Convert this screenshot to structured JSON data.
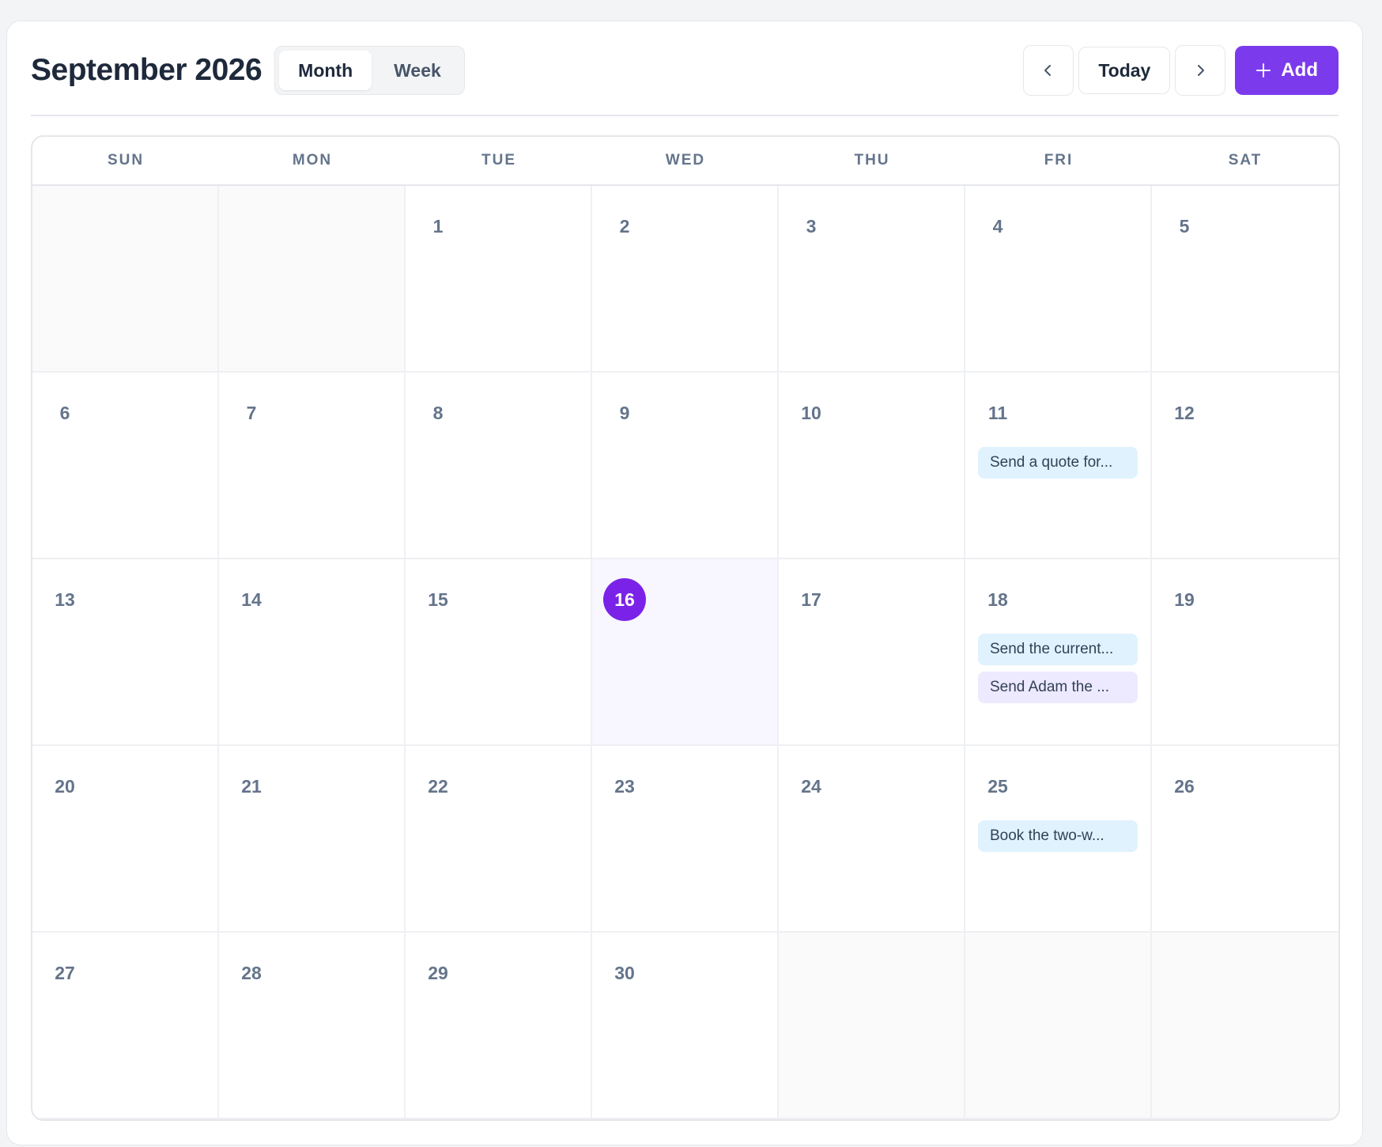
{
  "header": {
    "title": "September 2026",
    "view_toggle": {
      "month_label": "Month",
      "week_label": "Week",
      "active": "Month"
    },
    "prev_icon": "chevron-left-icon",
    "today_label": "Today",
    "next_icon": "chevron-right-icon",
    "add_label": "Add",
    "add_icon": "plus-icon",
    "accent_color": "#7c3aed"
  },
  "weekdays": [
    "SUN",
    "MON",
    "TUE",
    "WED",
    "THU",
    "FRI",
    "SAT"
  ],
  "weeks": [
    [
      {
        "day": ""
      },
      {
        "day": ""
      },
      {
        "day": "1"
      },
      {
        "day": "2"
      },
      {
        "day": "3"
      },
      {
        "day": "4"
      },
      {
        "day": "5"
      }
    ],
    [
      {
        "day": "6"
      },
      {
        "day": "7"
      },
      {
        "day": "8"
      },
      {
        "day": "9"
      },
      {
        "day": "10"
      },
      {
        "day": "11",
        "events": [
          {
            "title": "Send a quote for...",
            "color": "blue"
          }
        ]
      },
      {
        "day": "12"
      }
    ],
    [
      {
        "day": "13"
      },
      {
        "day": "14"
      },
      {
        "day": "15"
      },
      {
        "day": "16",
        "today": true
      },
      {
        "day": "17"
      },
      {
        "day": "18",
        "events": [
          {
            "title": "Send the current...",
            "color": "blue"
          },
          {
            "title": "Send Adam the ...",
            "color": "purple"
          }
        ]
      },
      {
        "day": "19"
      }
    ],
    [
      {
        "day": "20"
      },
      {
        "day": "21"
      },
      {
        "day": "22"
      },
      {
        "day": "23"
      },
      {
        "day": "24"
      },
      {
        "day": "25",
        "events": [
          {
            "title": "Book the two-w...",
            "color": "blue"
          }
        ]
      },
      {
        "day": "26"
      }
    ],
    [
      {
        "day": "27"
      },
      {
        "day": "28"
      },
      {
        "day": "29"
      },
      {
        "day": "30"
      },
      {
        "day": ""
      },
      {
        "day": ""
      },
      {
        "day": ""
      }
    ]
  ],
  "event_colors": {
    "blue": "#e0f2fe",
    "purple": "#ede9fe"
  },
  "today_color": "#7b22e8"
}
